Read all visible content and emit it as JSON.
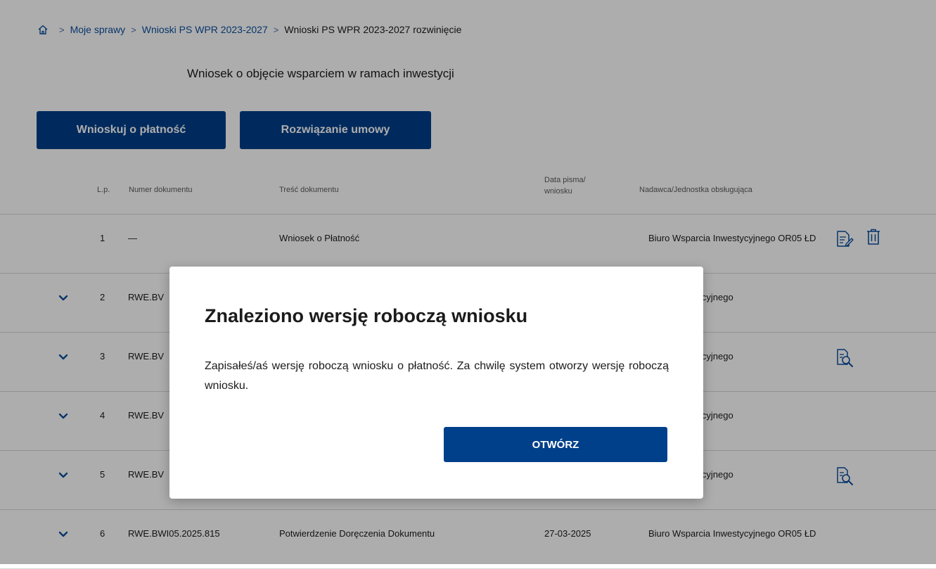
{
  "breadcrumb": {
    "home_icon": "home-icon",
    "items": [
      "Moje sprawy",
      "Wnioski PS WPR 2023-2027"
    ],
    "current": "Wnioski PS WPR 2023-2027 rozwinięcie",
    "separator": ">"
  },
  "header": {
    "title": "Wniosek o objęcie wsparciem w ramach inwestycji"
  },
  "actions": {
    "pay_label": "Wnioskuj o płatność",
    "terminate_label": "Rozwiązanie umowy"
  },
  "table": {
    "headers": {
      "lp": "L.p.",
      "number": "Numer dokumentu",
      "content": "Treść dokumentu",
      "date": "Data pisma/ wniosku",
      "sender": "Nadawca/Jednostka obsługująca"
    },
    "rows": [
      {
        "lp": "1",
        "number": "—",
        "content": "Wniosek o Płatność",
        "date": "",
        "sender": "Biuro Wsparcia Inwestycyjnego OR05 ŁD",
        "icons": [
          "edit-document-icon",
          "trash-icon"
        ]
      },
      {
        "lp": "2",
        "number": "RWE.BV",
        "content": "",
        "date": "",
        "sender": "arcia Inwestycyjnego",
        "icons": []
      },
      {
        "lp": "3",
        "number": "RWE.BV",
        "content": "",
        "date": "",
        "sender": "arcia Inwestycyjnego",
        "icons": [
          "document-preview-icon"
        ]
      },
      {
        "lp": "4",
        "number": "RWE.BV",
        "content": "",
        "date": "",
        "sender": "arcia Inwestycyjnego",
        "icons": []
      },
      {
        "lp": "5",
        "number": "RWE.BV",
        "content": "",
        "date": "",
        "sender": "arcia Inwestycyjnego",
        "icons": [
          "document-preview-icon"
        ]
      },
      {
        "lp": "6",
        "number": "RWE.BWI05.2025.815",
        "content": "Potwierdzenie Doręczenia Dokumentu",
        "date": "27-03-2025",
        "sender": "Biuro Wsparcia Inwestycyjnego OR05 ŁD",
        "icons": []
      }
    ]
  },
  "modal": {
    "title": "Znaleziono wersję roboczą wniosku",
    "message": "Zapisałeś/aś wersję roboczą wniosku o płatność. Za chwilę system otworzy wersję roboczą wniosku.",
    "button_label": "OTWÓRZ"
  },
  "colors": {
    "primary": "#003f8a",
    "link": "#0a4f9e",
    "overlay": "rgba(0,0,0,0.32)"
  }
}
